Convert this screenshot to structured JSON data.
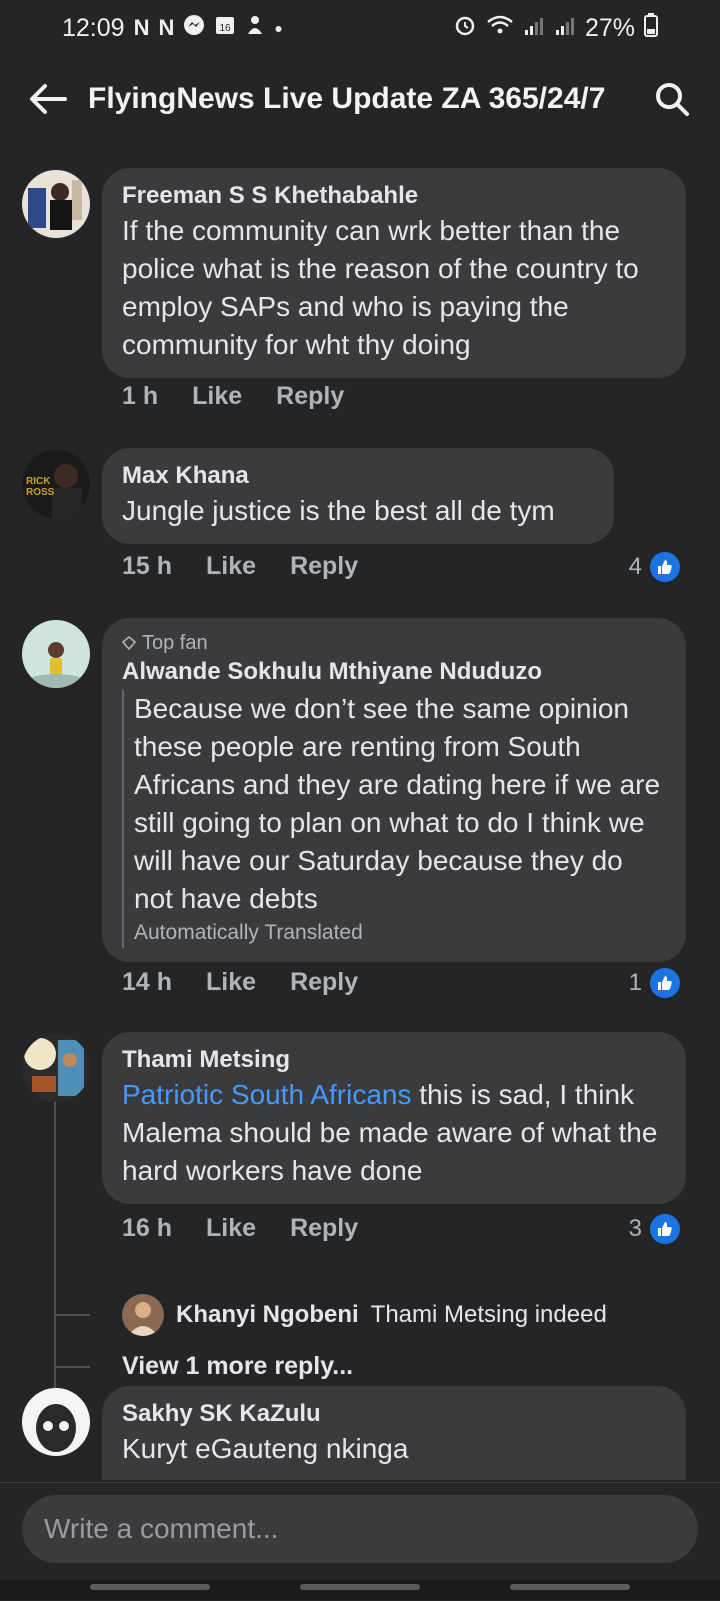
{
  "status_bar": {
    "time": "12:09",
    "left_icons": [
      "N",
      "N",
      "messenger-icon",
      "calendar-icon",
      "vpn-icon",
      "dot-icon"
    ],
    "calendar_day": "16",
    "right_icons": [
      "alarm-icon",
      "wifi-icon",
      "signal-icon",
      "signal-icon",
      "battery-icon"
    ],
    "battery": "27%"
  },
  "header": {
    "title": "FlyingNews Live Update ZA 365/24/7",
    "back_icon": "back-arrow-icon",
    "search_icon": "search-icon"
  },
  "comments": [
    {
      "author": "Freeman S S Khethabahle",
      "text": "If the community can wrk better than the police what is the reason of the country to employ SAPs and who is paying the community for wht thy doing",
      "time": "1 h",
      "like_label": "Like",
      "reply_label": "Reply"
    },
    {
      "author": "Max Khana",
      "text": "Jungle justice is the best all de tym",
      "time": "15 h",
      "like_label": "Like",
      "reply_label": "Reply",
      "reactions": "4"
    },
    {
      "badge": "Top fan",
      "author": "Alwande Sokhulu Mthiyane Nduduzo",
      "text": "Because we don’t see the same opinion these people are renting from South Africans and they are dating here if we are still going to plan on what to do I think we will have our Saturday because they do not have debts",
      "translation_note": "Automatically Translated",
      "time": "14 h",
      "like_label": "Like",
      "reply_label": "Reply",
      "reactions": "1"
    },
    {
      "author": "Thami Metsing",
      "mention": "Patriotic South Africans",
      "text": " this is sad, I think Malema  should be made aware of what the hard workers have done",
      "time": "16 h",
      "like_label": "Like",
      "reply_label": "Reply",
      "reactions": "3",
      "reply": {
        "author": "Khanyi Ngobeni",
        "text": "Thami Metsing indeed"
      },
      "more_replies": "View 1 more reply..."
    },
    {
      "author": "Sakhy SK KaZulu",
      "text": "Kuryt eGauteng nkinga"
    }
  ],
  "composer": {
    "placeholder": "Write a comment..."
  },
  "colors": {
    "background": "#242526",
    "bubble": "#3a3b3c",
    "accent": "#1b74e4",
    "link": "#4599ff"
  }
}
